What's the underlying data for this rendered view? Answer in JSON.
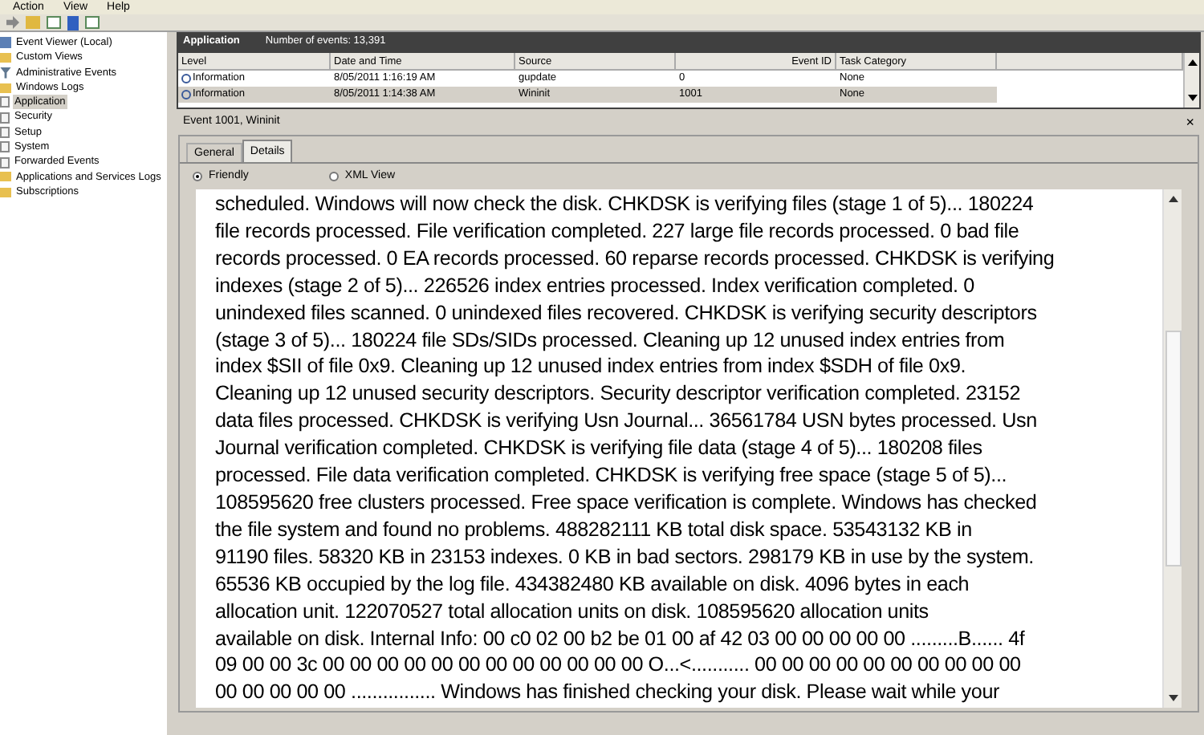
{
  "menu": [
    "Action",
    "View",
    "Help"
  ],
  "tree": [
    {
      "label": "Event Viewer (Local)",
      "kind": "viewer",
      "selected": false,
      "children": [
        {
          "label": "Custom Views",
          "kind": "folder",
          "selected": false,
          "children": [
            {
              "label": "Administrative Events",
              "kind": "filter",
              "selected": false
            }
          ]
        },
        {
          "label": "Windows Logs",
          "kind": "folder",
          "selected": false,
          "children": [
            {
              "label": "Application",
              "kind": "log",
              "selected": true
            },
            {
              "label": "Security",
              "kind": "log",
              "selected": false
            },
            {
              "label": "Setup",
              "kind": "log",
              "selected": false
            },
            {
              "label": "System",
              "kind": "log",
              "selected": false
            },
            {
              "label": "Forwarded Events",
              "kind": "log",
              "selected": false
            }
          ]
        },
        {
          "label": "Applications and Services Logs",
          "kind": "folder",
          "selected": false
        },
        {
          "label": "Subscriptions",
          "kind": "folder",
          "selected": false
        }
      ]
    }
  ],
  "header": {
    "title": "Application",
    "count": "Number of events: 13,391"
  },
  "table": {
    "columns": [
      "Level",
      "Date and Time",
      "Source",
      "Event ID",
      "Task Category"
    ],
    "rows": [
      {
        "cells": [
          "Information",
          "8/05/2011 1:16:19 AM",
          "gupdate",
          "0",
          "None"
        ],
        "selected": false
      },
      {
        "cells": [
          "Information",
          "8/05/2011 1:14:38 AM",
          "Wininit",
          "1001",
          "None"
        ],
        "selected": true
      }
    ]
  },
  "event": {
    "title": "Event 1001, Wininit",
    "close": "×",
    "tabs": [
      {
        "label": "General",
        "selected": false
      },
      {
        "label": "Details",
        "selected": true
      }
    ],
    "views": [
      {
        "label": "Friendly",
        "selected": true
      },
      {
        "label": "XML View",
        "selected": false
      }
    ],
    "lines": [
      "scheduled. Windows will now check the disk. CHKDSK is verifying files (stage 1 of 5)... 180224",
      "file records processed. File verification completed. 227 large file records processed. 0 bad file",
      "records processed. 0 EA records processed. 60 reparse records processed. CHKDSK is verifying",
      "indexes (stage 2 of 5)... 226526 index entries processed. Index verification completed. 0",
      "unindexed files scanned. 0 unindexed files recovered. CHKDSK is verifying security descriptors",
      "(stage 3 of 5)... 180224 file SDs/SIDs processed. Cleaning up 12 unused index entries from",
      "index $SII of file 0x9. Cleaning up 12 unused index entries from index $SDH of file 0x9.",
      "Cleaning up 12 unused security descriptors. Security descriptor verification completed. 23152",
      "data files processed. CHKDSK is verifying Usn Journal... 36561784 USN bytes processed. Usn",
      "Journal verification completed. CHKDSK is verifying file data (stage 4 of 5)... 180208 files",
      "processed. File data verification completed. CHKDSK is verifying free space (stage 5 of 5)...",
      "108595620 free clusters processed. Free space verification is complete. Windows has checked",
      "the file system and found no problems. 488282111 KB total disk space. 53543132 KB in",
      "91190 files. 58320 KB in 23153 indexes. 0 KB in bad sectors. 298179 KB in use by the system.",
      "65536 KB occupied by the log file. 434382480 KB available on disk. 4096 bytes in each",
      "allocation unit. 122070527 total allocation units on disk. 108595620 allocation units",
      "available on disk. Internal Info: 00 c0 02 00 b2 be 01 00 af 42 03 00 00 00 00 00 .........B...... 4f",
      "09 00 00 3c 00 00 00 00 00 00 00 00 00 00 00 00 O...<........... 00 00 00 00 00 00 00 00 00 00",
      "00 00 00 00 00 ................ Windows has finished checking your disk. Please wait while your"
    ]
  }
}
